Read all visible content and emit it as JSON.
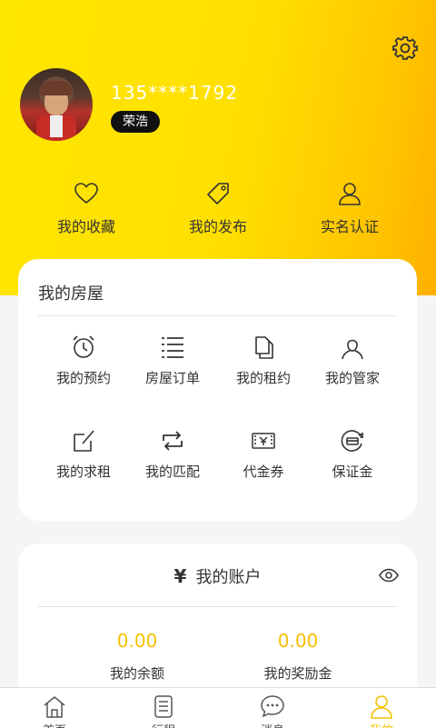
{
  "profile": {
    "phone": "135****1792",
    "nickname": "荣浩"
  },
  "quick_links": [
    {
      "label": "我的收藏",
      "icon": "heart-icon"
    },
    {
      "label": "我的发布",
      "icon": "tag-icon"
    },
    {
      "label": "实名认证",
      "icon": "person-icon"
    }
  ],
  "house": {
    "title": "我的房屋",
    "items": [
      {
        "label": "我的预约",
        "icon": "alarm-clock-icon"
      },
      {
        "label": "房屋订单",
        "icon": "list-icon"
      },
      {
        "label": "我的租约",
        "icon": "documents-icon"
      },
      {
        "label": "我的管家",
        "icon": "butler-icon"
      },
      {
        "label": "我的求租",
        "icon": "edit-icon"
      },
      {
        "label": "我的匹配",
        "icon": "exchange-icon"
      },
      {
        "label": "代金券",
        "icon": "voucher-icon"
      },
      {
        "label": "保证金",
        "icon": "deposit-icon"
      }
    ]
  },
  "account": {
    "currency_symbol": "¥",
    "title": "我的账户",
    "balance": {
      "value": "0.00",
      "label": "我的余额"
    },
    "reward": {
      "value": "0.00",
      "label": "我的奖励金"
    }
  },
  "tabs": [
    {
      "label": "首页",
      "icon": "home-icon",
      "active": false
    },
    {
      "label": "行程",
      "icon": "schedule-icon",
      "active": false
    },
    {
      "label": "消息",
      "icon": "message-icon",
      "active": false
    },
    {
      "label": "我的",
      "icon": "user-icon",
      "active": true
    }
  ],
  "colors": {
    "accent": "#ffe600",
    "amount": "#f5c000"
  }
}
